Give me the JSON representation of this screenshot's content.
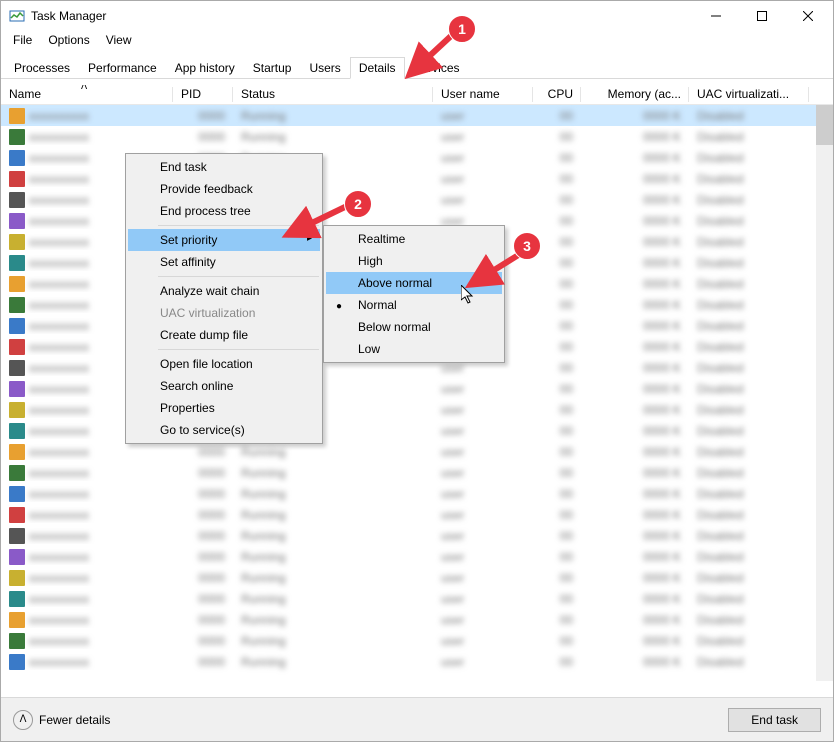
{
  "window": {
    "title": "Task Manager"
  },
  "menubar": [
    "File",
    "Options",
    "View"
  ],
  "tabs": [
    {
      "label": "Processes",
      "active": false
    },
    {
      "label": "Performance",
      "active": false
    },
    {
      "label": "App history",
      "active": false
    },
    {
      "label": "Startup",
      "active": false
    },
    {
      "label": "Users",
      "active": false
    },
    {
      "label": "Details",
      "active": true
    },
    {
      "label": "Services",
      "active": false
    }
  ],
  "columns": {
    "name": "Name",
    "pid": "PID",
    "status": "Status",
    "user": "User name",
    "cpu": "CPU",
    "memory": "Memory (ac...",
    "uac": "UAC virtualizati..."
  },
  "context_menu": {
    "items": [
      {
        "label": "End task"
      },
      {
        "label": "Provide feedback"
      },
      {
        "label": "End process tree"
      },
      {
        "sep": true
      },
      {
        "label": "Set priority",
        "submenu": true,
        "hover": true
      },
      {
        "label": "Set affinity"
      },
      {
        "sep": true
      },
      {
        "label": "Analyze wait chain"
      },
      {
        "label": "UAC virtualization",
        "disabled": true
      },
      {
        "label": "Create dump file"
      },
      {
        "sep": true
      },
      {
        "label": "Open file location"
      },
      {
        "label": "Search online"
      },
      {
        "label": "Properties"
      },
      {
        "label": "Go to service(s)"
      }
    ]
  },
  "priority_submenu": {
    "items": [
      {
        "label": "Realtime"
      },
      {
        "label": "High"
      },
      {
        "label": "Above normal",
        "hover": true
      },
      {
        "label": "Normal",
        "current": true
      },
      {
        "label": "Below normal"
      },
      {
        "label": "Low"
      }
    ]
  },
  "bottom": {
    "fewer": "Fewer details",
    "end_task": "End task"
  },
  "callouts": {
    "c1": "1",
    "c2": "2",
    "c3": "3"
  }
}
